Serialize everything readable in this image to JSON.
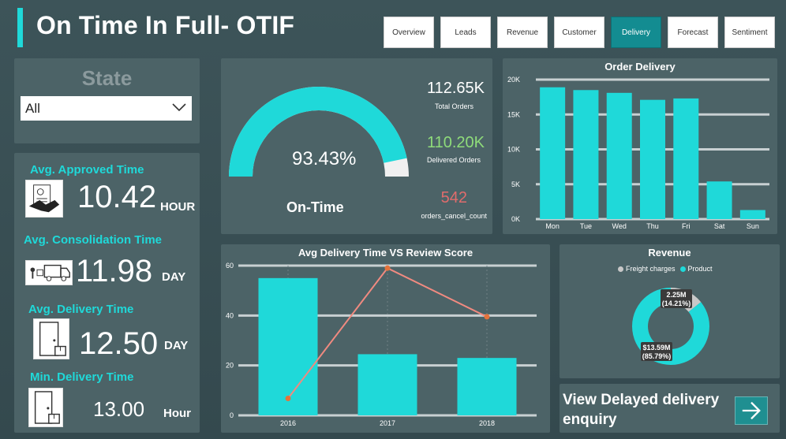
{
  "header": {
    "title": "On Time In Full- OTIF",
    "tabs": [
      {
        "label": "Overview",
        "active": false
      },
      {
        "label": "Leads",
        "active": false
      },
      {
        "label": "Revenue",
        "active": false
      },
      {
        "label": "Customer",
        "active": false
      },
      {
        "label": "Delivery",
        "active": true
      },
      {
        "label": "Forecast",
        "active": false
      },
      {
        "label": "Sentiment",
        "active": false
      }
    ]
  },
  "filter": {
    "title": "State",
    "selected": "All"
  },
  "metrics": {
    "approved": {
      "label": "Avg. Approved Time",
      "value": "10.42",
      "unit": "HOUR",
      "icon": "handshake-document-icon"
    },
    "consolidation": {
      "label": "Avg. Consolidation Time",
      "value": "11.98",
      "unit": "DAY",
      "icon": "delivery-truck-icon"
    },
    "delivery": {
      "label": "Avg. Delivery Time",
      "value": "12.50",
      "unit": "DAY",
      "icon": "door-package-icon"
    },
    "min_delivery": {
      "label": "Min. Delivery Time",
      "value": "13.00",
      "unit": "Hour",
      "icon": "door-package-icon"
    }
  },
  "ontime": {
    "gauge_value": "93.43%",
    "gauge_fraction": 0.9343,
    "label": "On-Time",
    "total_orders": {
      "value": "112.65K",
      "label": "Total Orders"
    },
    "delivered_orders": {
      "value": "110.20K",
      "label": "Delivered Orders"
    },
    "cancelled": {
      "value": "542",
      "label": "orders_cancel_count"
    }
  },
  "colors": {
    "accent": "#1fd9d9",
    "delivered_green": "#8fdc7a",
    "cancel_red": "#e06c6c",
    "line": "#f08a80",
    "active_tab": "#138c91"
  },
  "chart_data": [
    {
      "type": "bar",
      "title": "Order Delivery",
      "categories": [
        "Mon",
        "Tue",
        "Wed",
        "Thu",
        "Fri",
        "Sat",
        "Sun"
      ],
      "values": [
        18900,
        18500,
        18100,
        17100,
        17300,
        5400,
        1300
      ],
      "ylim": [
        0,
        20000
      ],
      "yticks": [
        "0K",
        "5K",
        "10K",
        "15K",
        "20K"
      ],
      "grid": true
    },
    {
      "type": "bar",
      "title": "Avg Delivery Time VS Review Score",
      "categories": [
        "2016",
        "2017",
        "2018"
      ],
      "series": [
        {
          "kind": "bar",
          "values": [
            55,
            24.5,
            23
          ]
        },
        {
          "kind": "line",
          "values": [
            6.8,
            59,
            39.5
          ]
        }
      ],
      "ylim": [
        0,
        60
      ],
      "yticks": [
        "0",
        "20",
        "40",
        "60"
      ],
      "grid": true
    },
    {
      "type": "pie",
      "title": "Revenue",
      "legend": [
        "Freight charges",
        "Product"
      ],
      "slices": [
        {
          "name": "Freight charges",
          "value": 2.25,
          "label": "2.25M",
          "pct": "(14.21%)",
          "color": "#c8c8c8"
        },
        {
          "name": "Product",
          "value": 13.59,
          "label": "$13.59M",
          "pct": "(85.79%)",
          "color": "#1fd9d9"
        }
      ],
      "legend_position": "top"
    }
  ],
  "cta": {
    "text_line1": "View Delayed delivery",
    "text_line2": "enquiry",
    "icon": "arrow-right-icon"
  }
}
